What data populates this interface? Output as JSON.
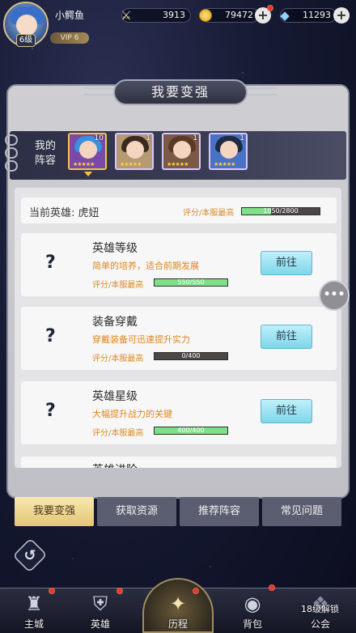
{
  "player": {
    "name": "小鳄鱼",
    "level": "6",
    "level_suffix": "级",
    "vip": "VIP 6"
  },
  "resources": [
    {
      "icon": "swords-icon",
      "value": "3913"
    },
    {
      "icon": "gold-coin-icon",
      "value": "79472"
    },
    {
      "icon": "diamond-icon",
      "value": "11293"
    }
  ],
  "page_title": "我要变强",
  "lineup": {
    "label": "我的阵容",
    "heroes": [
      {
        "level": "10",
        "stars": "★★★★★",
        "bg": "#7a4aa8",
        "hair": "#3b8fdc",
        "selected": true
      },
      {
        "level": "1",
        "stars": "★★★★★",
        "bg": "#b69a74",
        "hair": "#3b2a1e"
      },
      {
        "level": "1",
        "stars": "★★★★★",
        "bg": "#7a5a46",
        "hair": "#5a3a26"
      },
      {
        "level": "1",
        "stars": "★★★★★",
        "bg": "#4a72c4",
        "hair": "#1f2a44"
      }
    ]
  },
  "current_hero": {
    "label": "当前英雄: 虎妞",
    "score_label": "评分/本服最高",
    "score_text": "1050/2800",
    "progress": 0.375
  },
  "cards": [
    {
      "title": "英雄等级",
      "desc": "简单的培养，适合前期发展",
      "score_label": "评分/本服最高",
      "score_text": "550/550",
      "progress": 1.0,
      "button": "前往"
    },
    {
      "title": "装备穿戴",
      "desc": "穿戴装备可迅速提升实力",
      "score_label": "评分/本服最高",
      "score_text": "0/400",
      "progress": 0.0,
      "button": "前往"
    },
    {
      "title": "英雄星级",
      "desc": "大幅提升战力的关键",
      "score_label": "评分/本服最高",
      "score_text": "400/400",
      "progress": 1.0,
      "button": "前往"
    }
  ],
  "partial_card_title": "英雄进阶",
  "unknown_icon": "?",
  "chat_icon": "•••",
  "tabs": [
    "我要变强",
    "获取资源",
    "推荐阵容",
    "常见问题"
  ],
  "nav": [
    {
      "label": "主城"
    },
    {
      "label": "英雄"
    },
    {
      "label": "历程"
    },
    {
      "label": "背包"
    },
    {
      "label": "公会"
    }
  ],
  "unlock_note": "18级解锁",
  "colors": {
    "accent_orange": "#e0861a",
    "progress_green": "#7fe08a",
    "button_cyan": "#7fd6ea",
    "active_tab": "#e3c677"
  }
}
